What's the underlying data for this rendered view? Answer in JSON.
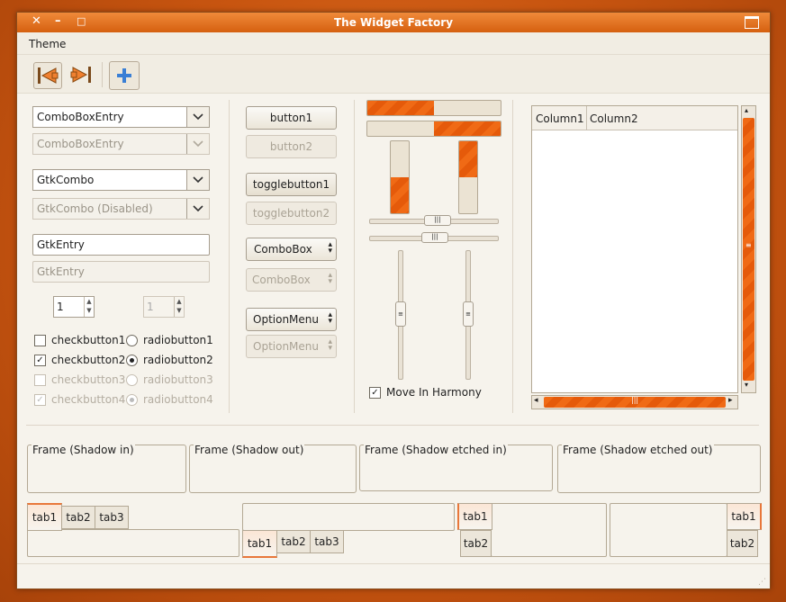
{
  "window": {
    "title": "The Widget Factory"
  },
  "menu": {
    "theme": "Theme"
  },
  "left": {
    "combo1": "ComboBoxEntry",
    "combo1_dis": "ComboBoxEntry",
    "combo2": "GtkCombo",
    "combo2_dis": "GtkCombo (Disabled)",
    "entry": "GtkEntry",
    "entry_placeholder": "GtkEntry",
    "spin1": "1",
    "spin2": "1",
    "check1": "checkbutton1",
    "check2": "checkbutton2",
    "check3": "checkbutton3",
    "check4": "checkbutton4",
    "radio1": "radiobutton1",
    "radio2": "radiobutton2",
    "radio3": "radiobutton3",
    "radio4": "radiobutton4"
  },
  "buttons": {
    "button1": "button1",
    "button2": "button2",
    "toggle1": "togglebutton1",
    "toggle2": "togglebutton2",
    "combobox1": "ComboBox",
    "combobox2": "ComboBox",
    "option1": "OptionMenu",
    "option2": "OptionMenu"
  },
  "progress": {
    "h1": 0.5,
    "h2": 0.5,
    "v1": 0.5,
    "v2": 0.5
  },
  "sliders": {
    "move_harmony": "Move In Harmony"
  },
  "tree": {
    "col1": "Column1",
    "col2": "Column2"
  },
  "frames": [
    "Frame (Shadow in)",
    "Frame (Shadow out)",
    "Frame (Shadow etched in)",
    "Frame (Shadow etched out)"
  ],
  "tabs": {
    "t1": "tab1",
    "t2": "tab2",
    "t3": "tab3"
  },
  "colors": {
    "accent": "#e8651a",
    "titlebar": "#e06b1e"
  }
}
